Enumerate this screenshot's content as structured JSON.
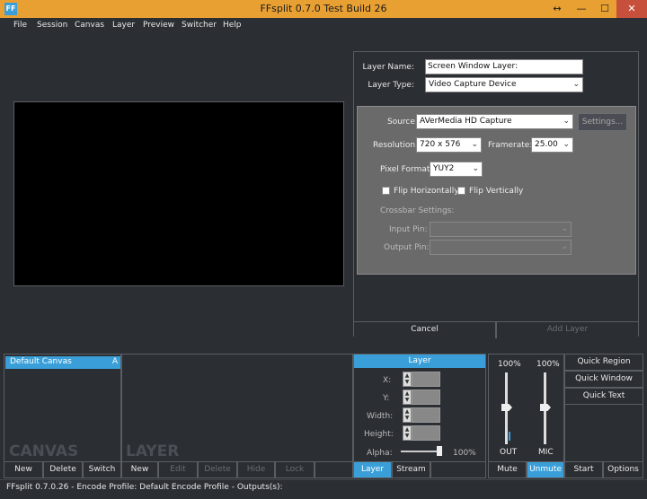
{
  "window": {
    "title": "FFsplit 0.7.0 Test Build 26",
    "app_icon": "FF",
    "resize_glyph": "↔",
    "minimize": "—",
    "maximize": "☐",
    "close": "✕"
  },
  "menu": [
    "File",
    "Session",
    "Canvas",
    "Layer",
    "Preview",
    "Switcher",
    "Help"
  ],
  "layer_form": {
    "name_label": "Layer Name:",
    "name_value": "Screen Window Layer:",
    "type_label": "Layer Type:",
    "type_value": "Video Capture Device",
    "source_label": "Source:",
    "source_value": "AVerMedia HD Capture",
    "settings_button": "Settings...",
    "resolution_label": "Resolution:",
    "resolution_value": "720 x 576",
    "framerate_label": "Framerate:",
    "framerate_value": "25.00",
    "pixel_format_label": "Pixel Format:",
    "pixel_format_value": "YUY2",
    "flip_h": "Flip Horizontally",
    "flip_v": "Flip Vertically",
    "crossbar_label": "Crossbar Settings:",
    "input_pin_label": "Input Pin:",
    "output_pin_label": "Output Pin:",
    "cancel_button": "Cancel",
    "add_layer_button": "Add Layer"
  },
  "canvas_panel": {
    "selected_item": "Default Canvas",
    "item_badge": "A",
    "watermark": "CANVAS",
    "buttons": [
      "New",
      "Delete",
      "Switch"
    ]
  },
  "layer_panel": {
    "watermark": "LAYER",
    "buttons": [
      "New",
      "Edit",
      "Delete",
      "Hide",
      "Lock"
    ]
  },
  "layer_props": {
    "header": "Layer",
    "x_label": "X:",
    "y_label": "Y:",
    "width_label": "Width:",
    "height_label": "Height:",
    "alpha_label": "Alpha:",
    "alpha_value": "100%",
    "alpha_level": 1.0,
    "tab_layer": "Layer",
    "tab_stream": "Stream"
  },
  "audio": {
    "out_pct": "100%",
    "mic_pct": "100%",
    "out_label": "OUT",
    "mic_label": "MIC",
    "out_level": 1.0,
    "mic_level": 1.0,
    "mute_button": "Mute",
    "unmute_button": "Unmute"
  },
  "quick": {
    "region": "Quick Region",
    "window": "Quick Window",
    "text": "Quick Text",
    "start": "Start",
    "options": "Options"
  },
  "status": "FFsplit 0.7.0.26 - Encode Profile: Default Encode Profile - Outputs(s):",
  "colors": {
    "accent": "#3a9fd8",
    "titlebar": "#e8a033",
    "background": "#2b2e33"
  }
}
